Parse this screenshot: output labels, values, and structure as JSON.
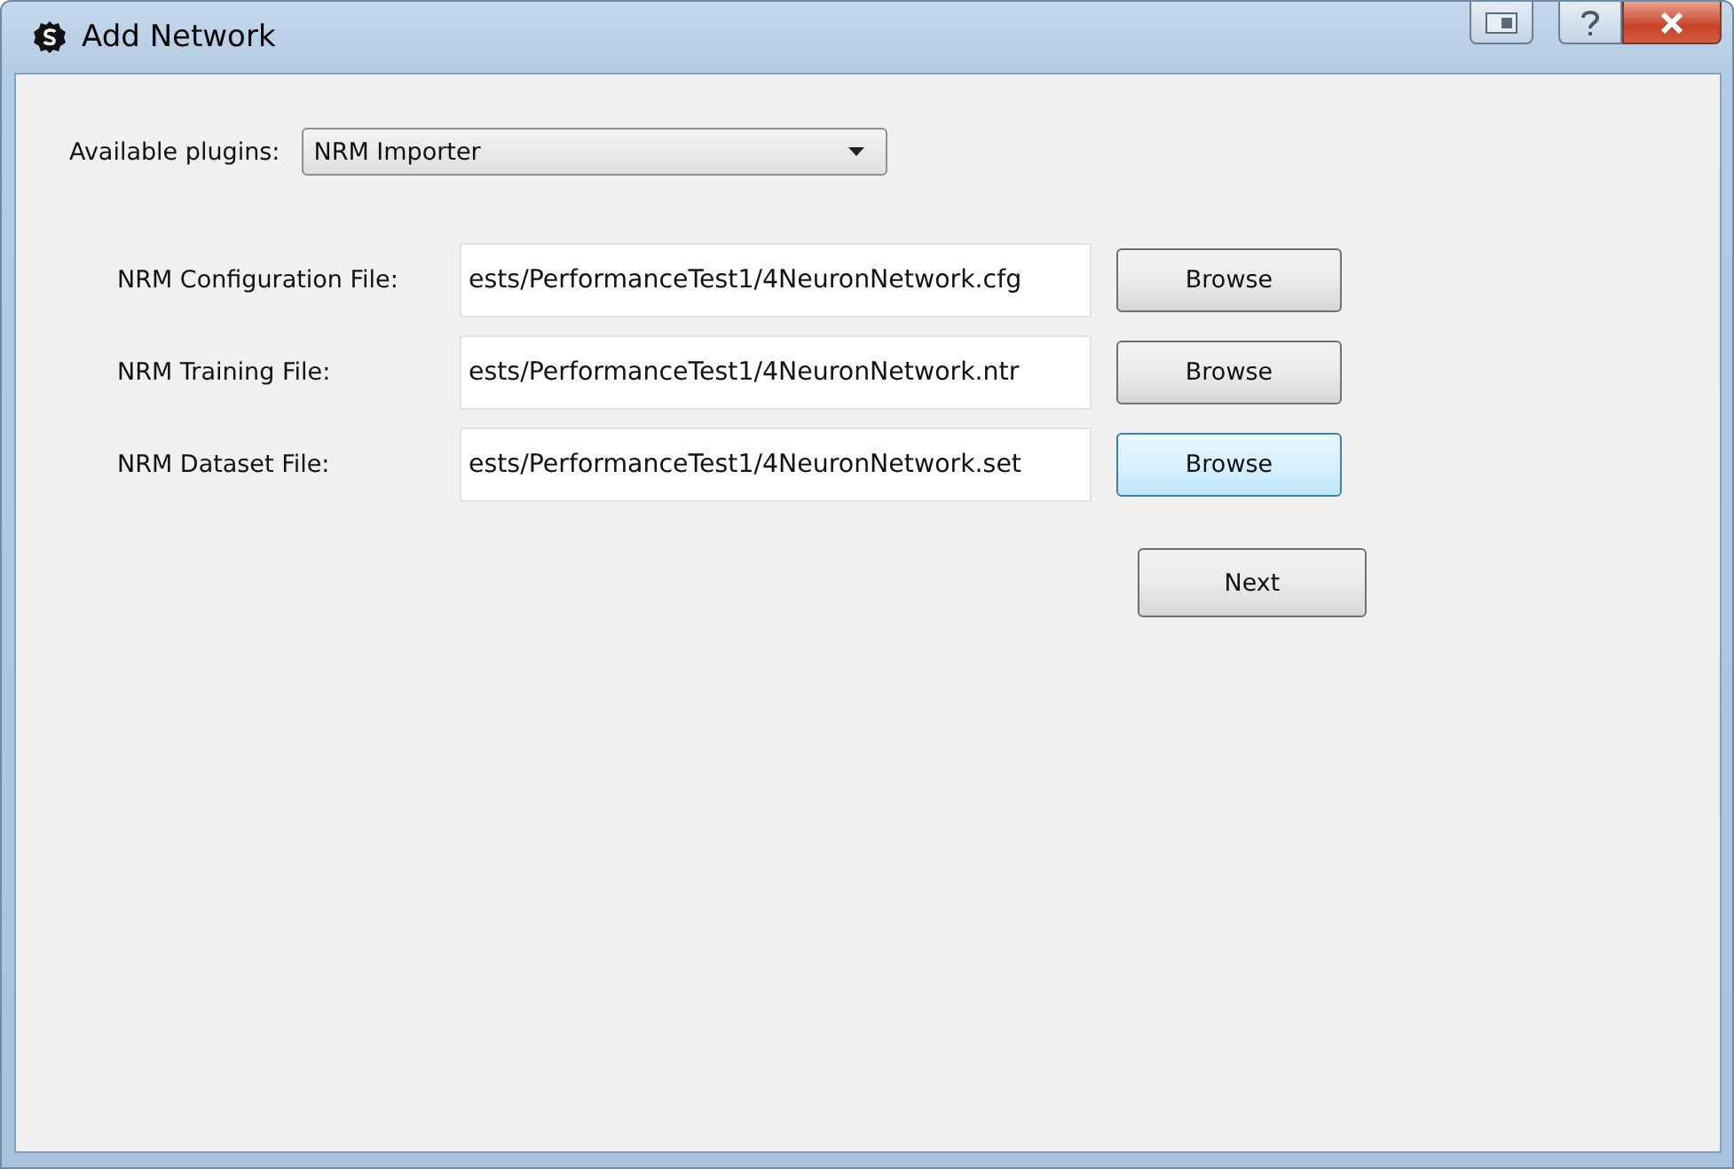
{
  "window": {
    "title": "Add Network"
  },
  "plugin": {
    "label": "Available plugins:",
    "value": "NRM Importer"
  },
  "files": [
    {
      "label": "NRM Configuration File:",
      "value": "ests/PerformanceTest1/4NeuronNetwork.cfg",
      "button": "Browse",
      "focused": false
    },
    {
      "label": "NRM Training File:",
      "value": "ests/PerformanceTest1/4NeuronNetwork.ntr",
      "button": "Browse",
      "focused": false
    },
    {
      "label": "NRM Dataset File:",
      "value": "ests/PerformanceTest1/4NeuronNetwork.set",
      "button": "Browse",
      "focused": true
    }
  ],
  "next_button": "Next"
}
